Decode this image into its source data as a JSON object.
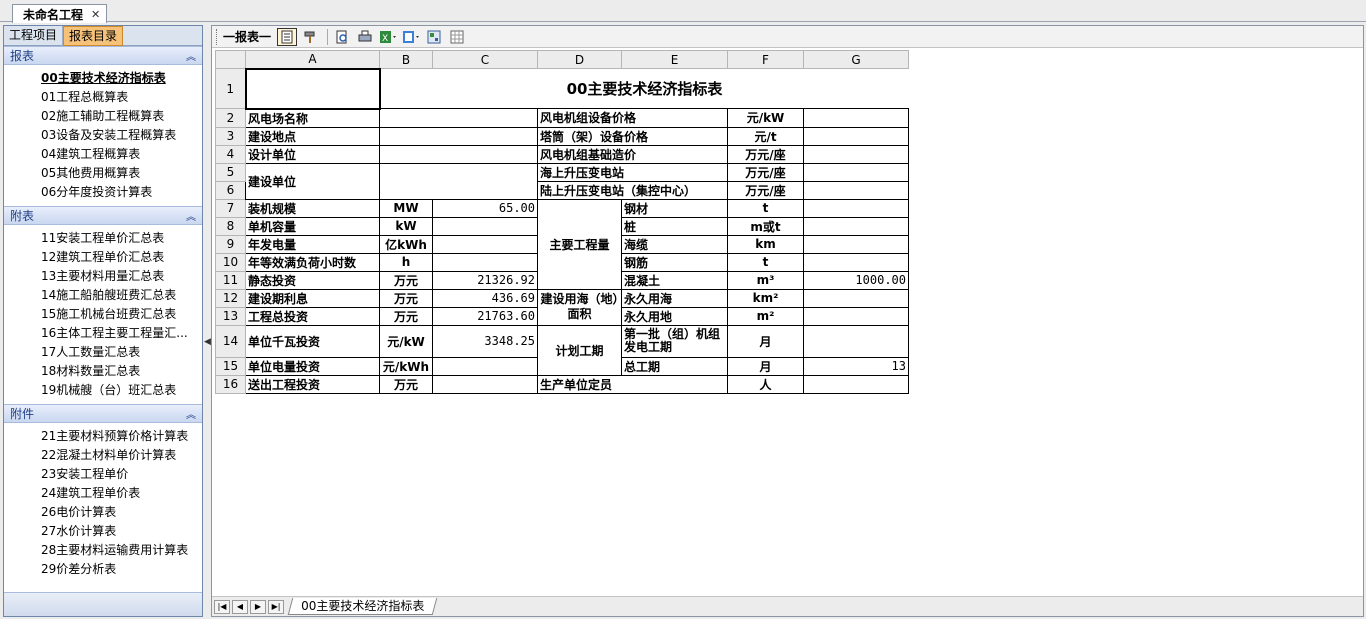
{
  "doc_tab": {
    "title": "未命名工程",
    "close": "✕"
  },
  "left_panel": {
    "tabs": [
      "工程项目",
      "报表目录"
    ],
    "sections": [
      {
        "title": "报表",
        "items": [
          "00主要技术经济指标表",
          "01工程总概算表",
          "02施工辅助工程概算表",
          "03设备及安装工程概算表",
          "04建筑工程概算表",
          "05其他费用概算表",
          "06分年度投资计算表"
        ]
      },
      {
        "title": "附表",
        "items": [
          "11安装工程单价汇总表",
          "12建筑工程单价汇总表",
          "13主要材料用量汇总表",
          "14施工船舶艘班费汇总表",
          "15施工机械台班费汇总表",
          "16主体工程主要工程量汇...",
          "17人工数量汇总表",
          "18材料数量汇总表",
          "19机械艘（台）班汇总表"
        ]
      },
      {
        "title": "附件",
        "items": [
          "21主要材料预算价格计算表",
          "22混凝土材料单价计算表",
          "23安装工程单价",
          "24建筑工程单价表",
          "26电价计算表",
          "27水价计算表",
          "28主要材料运输费用计算表",
          "29价差分析表"
        ]
      }
    ],
    "collapse_glyph": "︽"
  },
  "toolbar": {
    "label": "一报表一"
  },
  "sheet": {
    "col_headers": [
      "A",
      "B",
      "C",
      "D",
      "E",
      "F",
      "G"
    ],
    "title": "00主要技术经济指标表",
    "rows": [
      {
        "n": "2",
        "a": "风电场名称",
        "b": "",
        "c": "",
        "e": "风电机组设备价格",
        "f": "元/kW",
        "g": ""
      },
      {
        "n": "3",
        "a": "建设地点",
        "b": "",
        "c": "",
        "e": "塔筒（架）设备价格",
        "f": "元/t",
        "g": ""
      },
      {
        "n": "4",
        "a": "设计单位",
        "b": "",
        "c": "",
        "e": "风电机组基础造价",
        "f": "万元/座",
        "g": ""
      },
      {
        "n": "5",
        "a": "建设单位",
        "b": "",
        "c": "",
        "e": "海上升压变电站",
        "f": "万元/座",
        "g": ""
      },
      {
        "n": "6",
        "a": "",
        "b": "",
        "c": "",
        "e": "陆上升压变电站（集控中心）",
        "f": "万元/座",
        "g": ""
      },
      {
        "n": "7",
        "a": "装机规模",
        "b": "MW",
        "c": "65.00",
        "d": "主要工程量",
        "e": "钢材",
        "f": "t",
        "g": ""
      },
      {
        "n": "8",
        "a": "单机容量",
        "b": "kW",
        "c": "",
        "e": "桩",
        "f": "m或t",
        "g": ""
      },
      {
        "n": "9",
        "a": "年发电量",
        "b": "亿kWh",
        "c": "",
        "e": "海缆",
        "f": "km",
        "g": ""
      },
      {
        "n": "10",
        "a": "年等效满负荷小时数",
        "b": "h",
        "c": "",
        "e": "钢筋",
        "f": "t",
        "g": ""
      },
      {
        "n": "11",
        "a": "静态投资",
        "b": "万元",
        "c": "21326.92",
        "e": "混凝土",
        "f": "m³",
        "g": "1000.00"
      },
      {
        "n": "12",
        "a": "建设期利息",
        "b": "万元",
        "c": "436.69",
        "d": "建设用海（地）面积",
        "e": "永久用海",
        "f": "km²",
        "g": ""
      },
      {
        "n": "13",
        "a": "工程总投资",
        "b": "万元",
        "c": "21763.60",
        "e": "永久用地",
        "f": "m²",
        "g": ""
      },
      {
        "n": "14",
        "a": "单位千瓦投资",
        "b": "元/kW",
        "c": "3348.25",
        "d": "计划工期",
        "e": "第一批（组）机组发电工期",
        "f": "月",
        "g": ""
      },
      {
        "n": "15",
        "a": "单位电量投资",
        "b": "元/kWh",
        "c": "",
        "e": "总工期",
        "f": "月",
        "g": "13"
      },
      {
        "n": "16",
        "a": "送出工程投资",
        "b": "万元",
        "c": "",
        "d": "生产单位定员",
        "f": "人",
        "g": ""
      }
    ],
    "tab_name": "00主要技术经济指标表"
  }
}
